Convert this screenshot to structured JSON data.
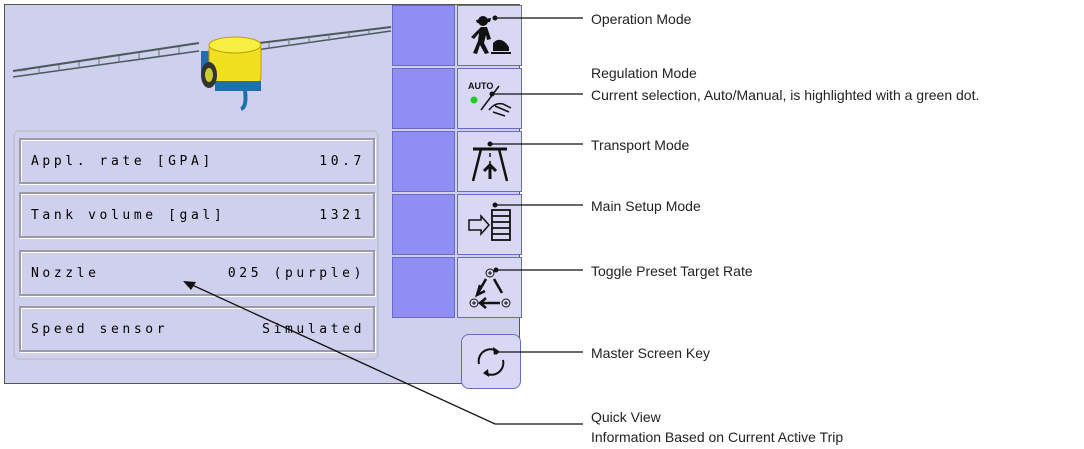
{
  "quick_view": {
    "rows": [
      {
        "label": "Appl. rate [GPA]",
        "value": "10.7"
      },
      {
        "label": "Tank volume [gal]",
        "value": "1321"
      },
      {
        "label": "Nozzle",
        "value": "025 (purple)"
      },
      {
        "label": "Speed sensor",
        "value": "Simulated"
      }
    ]
  },
  "regulation_button": {
    "auto_text": "AUTO"
  },
  "callouts": {
    "operation_mode": "Operation Mode",
    "regulation_mode_title": "Regulation Mode",
    "regulation_mode_desc": "Current selection, Auto/Manual, is highlighted with a green dot.",
    "transport_mode": "Transport Mode",
    "main_setup_mode": "Main Setup Mode",
    "toggle_preset": "Toggle Preset Target Rate",
    "master_screen_key": "Master Screen Key",
    "quick_view_title": "Quick View",
    "quick_view_desc": "Information Based on Current Active Trip"
  },
  "colors": {
    "screen_bg": "#cfcfee",
    "blank_button": "#8e8ef5",
    "icon_button": "#d8d8f4",
    "auto_dot": "#22cc22"
  },
  "icons": [
    "operator-icon",
    "auto-manual-icon",
    "transport-icon",
    "setup-icon",
    "preset-rate-icon",
    "master-key-icon",
    "sprayer-image"
  ]
}
